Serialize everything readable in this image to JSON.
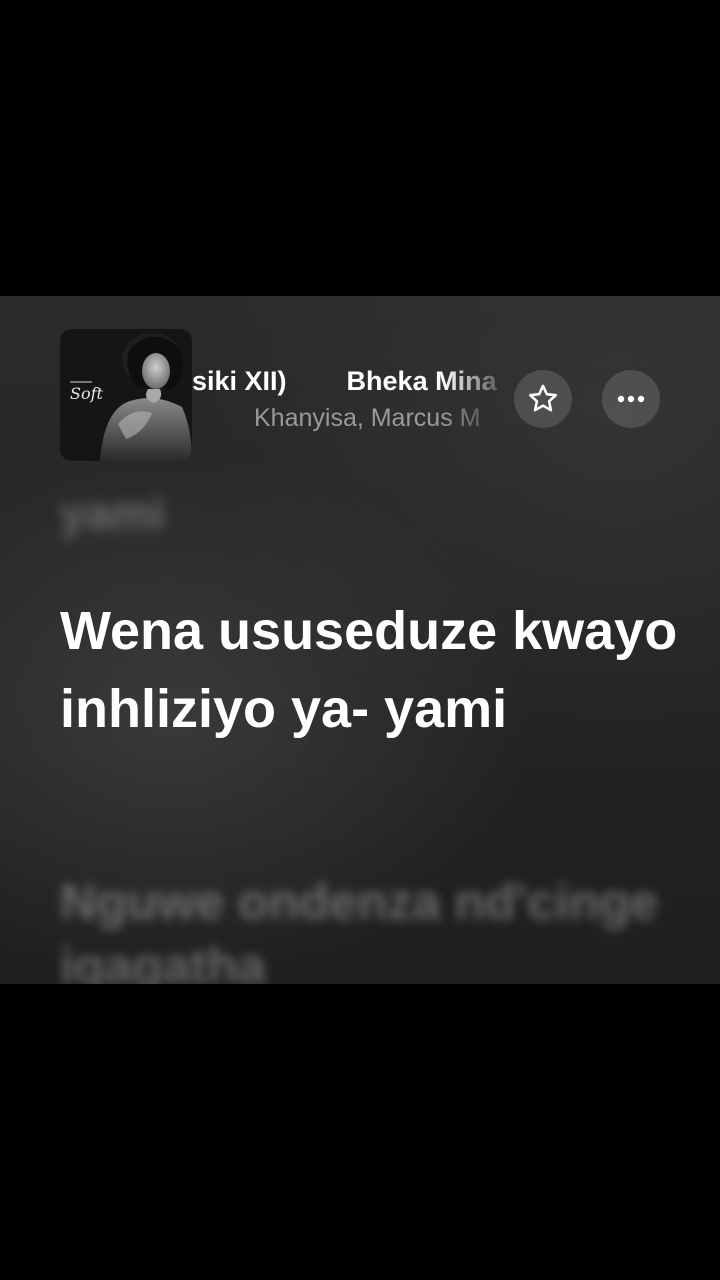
{
  "header": {
    "album_art": {
      "cover_text": "Soft",
      "icon": "album-cover"
    },
    "title_fragment": "siki XII)",
    "title_next": "Bheka Mina",
    "artists": "Khanyisa, Marcus M",
    "favorite_icon": "star-outline-icon",
    "more_icon": "ellipsis-icon"
  },
  "lyrics": {
    "previous": "yami",
    "current": "Wena ususeduze kwayo inhliziyo ya- yami",
    "next": "Nguwe ondenza nd'cinge iqagatha"
  },
  "colors": {
    "background": "#262626",
    "text_primary": "#ffffff",
    "text_secondary": "#9a9a9a"
  }
}
